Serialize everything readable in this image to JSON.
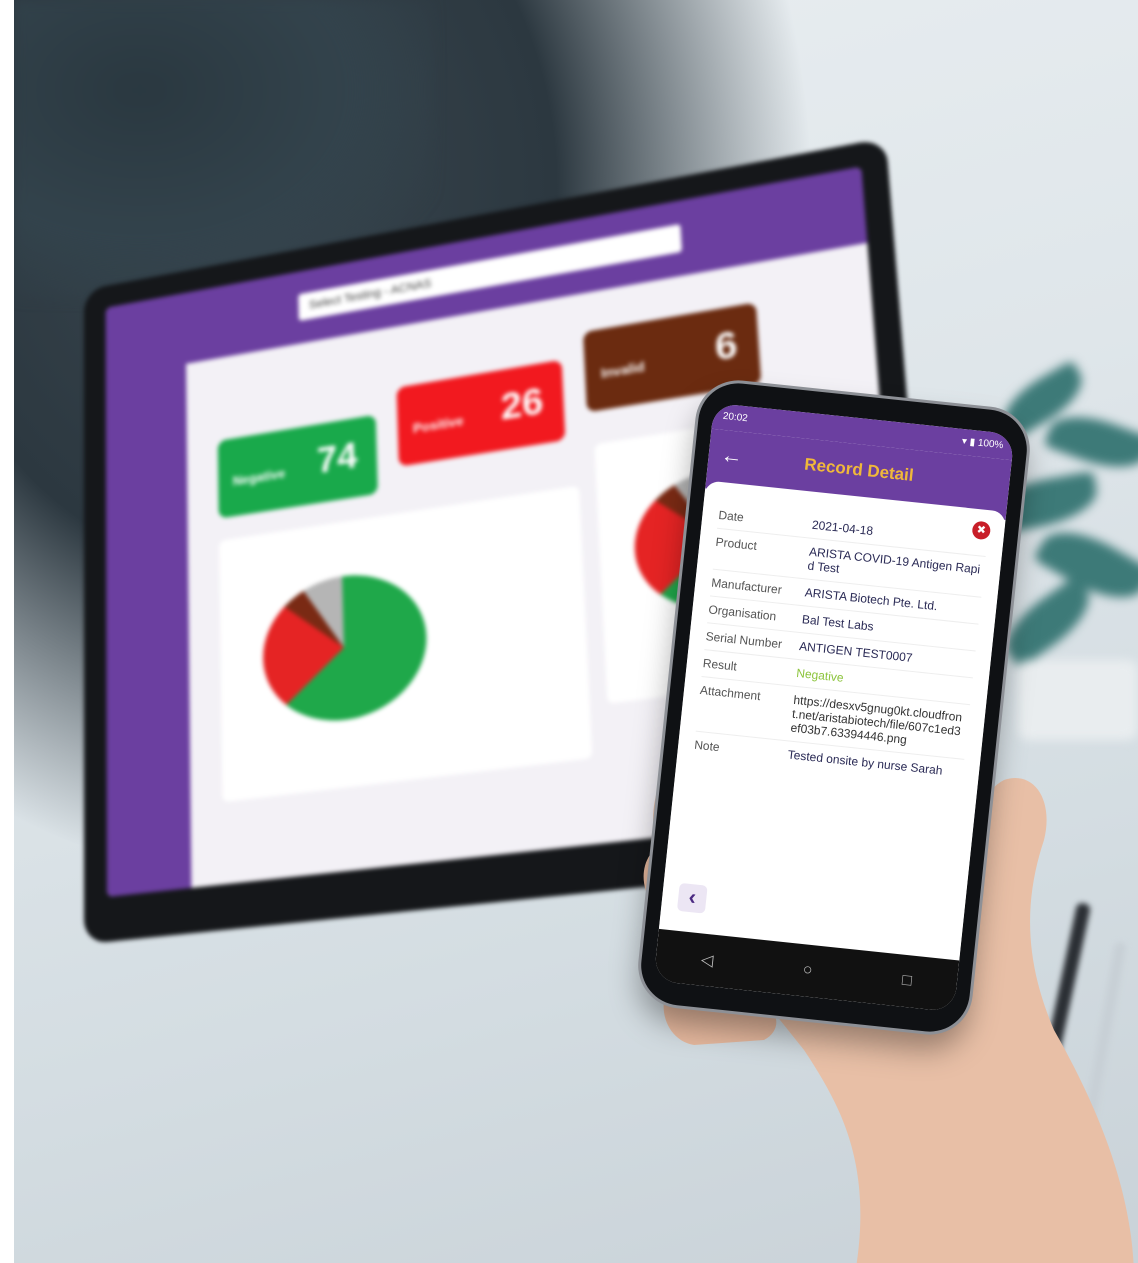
{
  "laptop": {
    "search_text": "Select Testing - ACNAS",
    "tiles": [
      {
        "label": "Negative",
        "value": "74",
        "color": "#19a94b"
      },
      {
        "label": "Positive",
        "value": "26",
        "color": "#f2191f"
      },
      {
        "label": "Invalid",
        "value": "6",
        "color": "#6b2b10"
      }
    ],
    "pie_colors": [
      "#1fa84a",
      "#e52424",
      "#7a2a14",
      "#b5b5b5"
    ]
  },
  "phone": {
    "status_time": "20:02",
    "status_right": "100%",
    "title": "Record Detail",
    "back_icon": "arrow-left-icon",
    "delete_icon": "trash-icon",
    "fields": [
      {
        "label": "Date",
        "value": "2021-04-18"
      },
      {
        "label": "Product",
        "value": "ARISTA COVID-19 Antigen Rapid Test"
      },
      {
        "label": "Manufacturer",
        "value": "ARISTA Biotech Pte. Ltd."
      },
      {
        "label": "Organisation",
        "value": "Bal Test Labs"
      },
      {
        "label": "Serial Number",
        "value": "ANTIGEN TEST0007"
      },
      {
        "label": "Result",
        "value": "Negative"
      },
      {
        "label": "Attachment",
        "value": "https://desxv5gnug0kt.cloudfront.net/aristabiotech/file/607c1ed3ef03b7.63394446.png"
      },
      {
        "label": "Note",
        "value": "Tested onsite by nurse Sarah"
      }
    ],
    "accent_color": "#6b3fa0",
    "title_color": "#f0b83a",
    "result_color": "#8cc43c"
  }
}
